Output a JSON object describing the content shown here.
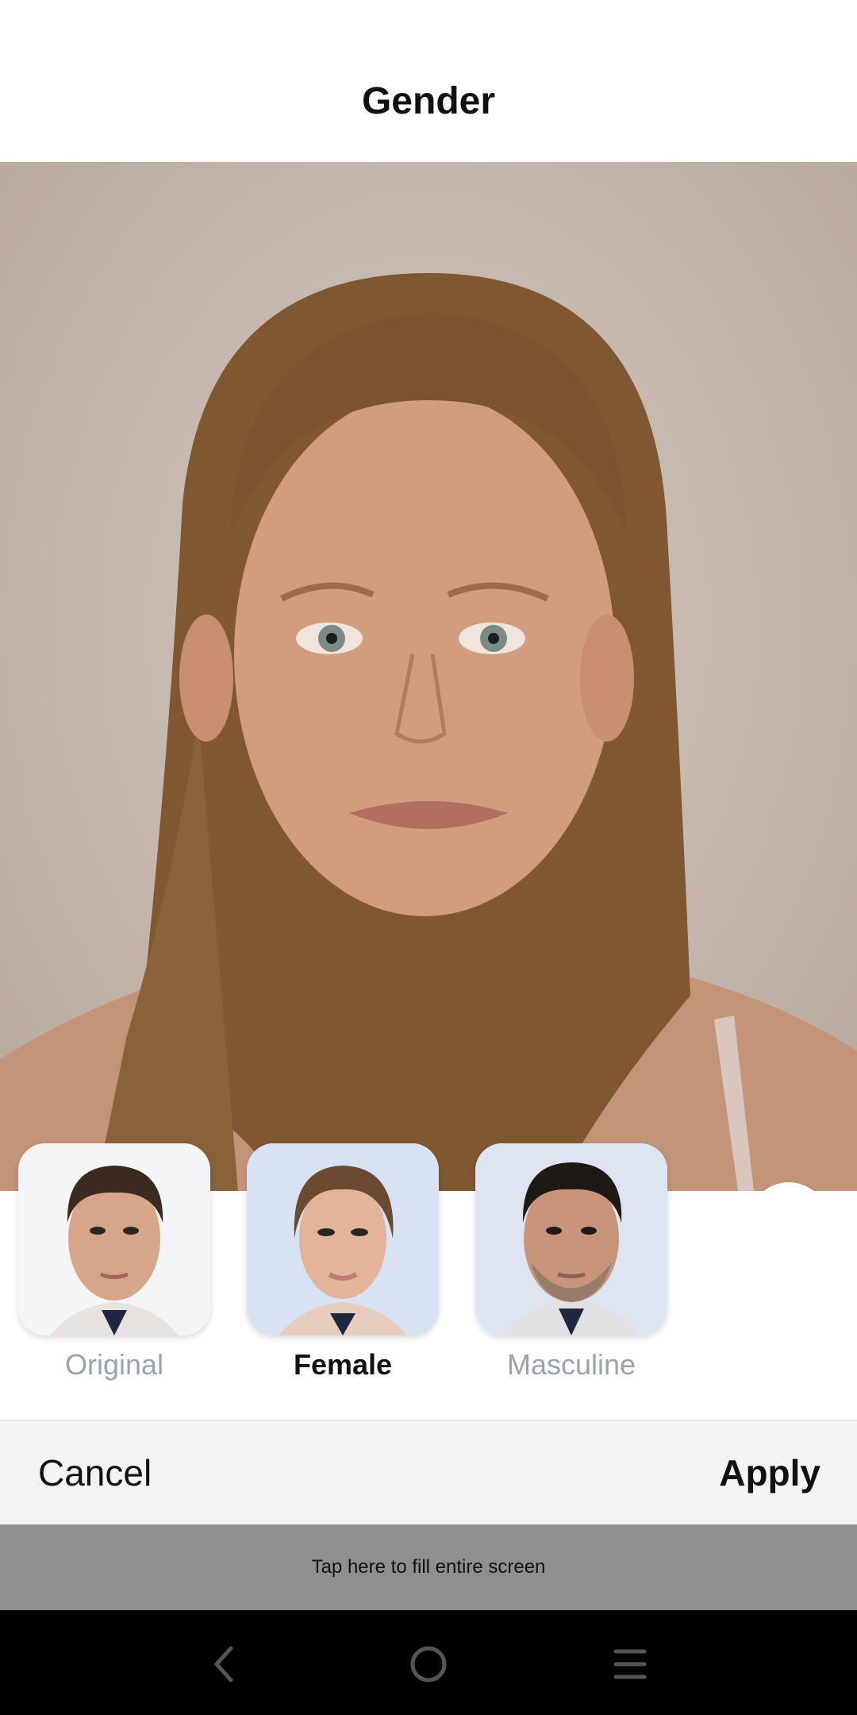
{
  "header": {
    "title": "Gender"
  },
  "filters": [
    {
      "label": "Original",
      "active": false
    },
    {
      "label": "Female",
      "active": true
    },
    {
      "label": "Masculine",
      "active": false
    }
  ],
  "actions": {
    "cancel": "Cancel",
    "apply": "Apply"
  },
  "banner": {
    "text": "Tap here to fill entire screen"
  },
  "icons": {
    "compare": "compare-split-icon",
    "back": "back-icon",
    "home": "home-icon",
    "menu": "menu-icon"
  },
  "colors": {
    "active_label": "#111111",
    "inactive_label": "#9aa3ad",
    "action_bar": "#f4f4f4",
    "banner": "#8f8f8f"
  }
}
